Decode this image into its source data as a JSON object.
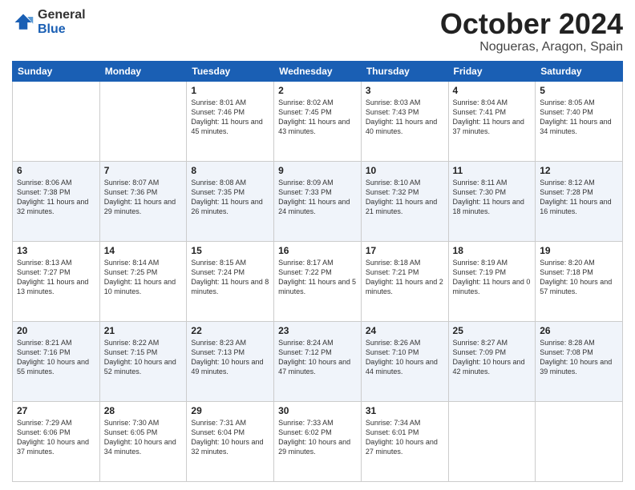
{
  "logo": {
    "general": "General",
    "blue": "Blue"
  },
  "title": "October 2024",
  "subtitle": "Nogueras, Aragon, Spain",
  "days_of_week": [
    "Sunday",
    "Monday",
    "Tuesday",
    "Wednesday",
    "Thursday",
    "Friday",
    "Saturday"
  ],
  "weeks": [
    [
      {
        "day": "",
        "info": ""
      },
      {
        "day": "",
        "info": ""
      },
      {
        "day": "1",
        "info": "Sunrise: 8:01 AM\nSunset: 7:46 PM\nDaylight: 11 hours and 45 minutes."
      },
      {
        "day": "2",
        "info": "Sunrise: 8:02 AM\nSunset: 7:45 PM\nDaylight: 11 hours and 43 minutes."
      },
      {
        "day": "3",
        "info": "Sunrise: 8:03 AM\nSunset: 7:43 PM\nDaylight: 11 hours and 40 minutes."
      },
      {
        "day": "4",
        "info": "Sunrise: 8:04 AM\nSunset: 7:41 PM\nDaylight: 11 hours and 37 minutes."
      },
      {
        "day": "5",
        "info": "Sunrise: 8:05 AM\nSunset: 7:40 PM\nDaylight: 11 hours and 34 minutes."
      }
    ],
    [
      {
        "day": "6",
        "info": "Sunrise: 8:06 AM\nSunset: 7:38 PM\nDaylight: 11 hours and 32 minutes."
      },
      {
        "day": "7",
        "info": "Sunrise: 8:07 AM\nSunset: 7:36 PM\nDaylight: 11 hours and 29 minutes."
      },
      {
        "day": "8",
        "info": "Sunrise: 8:08 AM\nSunset: 7:35 PM\nDaylight: 11 hours and 26 minutes."
      },
      {
        "day": "9",
        "info": "Sunrise: 8:09 AM\nSunset: 7:33 PM\nDaylight: 11 hours and 24 minutes."
      },
      {
        "day": "10",
        "info": "Sunrise: 8:10 AM\nSunset: 7:32 PM\nDaylight: 11 hours and 21 minutes."
      },
      {
        "day": "11",
        "info": "Sunrise: 8:11 AM\nSunset: 7:30 PM\nDaylight: 11 hours and 18 minutes."
      },
      {
        "day": "12",
        "info": "Sunrise: 8:12 AM\nSunset: 7:28 PM\nDaylight: 11 hours and 16 minutes."
      }
    ],
    [
      {
        "day": "13",
        "info": "Sunrise: 8:13 AM\nSunset: 7:27 PM\nDaylight: 11 hours and 13 minutes."
      },
      {
        "day": "14",
        "info": "Sunrise: 8:14 AM\nSunset: 7:25 PM\nDaylight: 11 hours and 10 minutes."
      },
      {
        "day": "15",
        "info": "Sunrise: 8:15 AM\nSunset: 7:24 PM\nDaylight: 11 hours and 8 minutes."
      },
      {
        "day": "16",
        "info": "Sunrise: 8:17 AM\nSunset: 7:22 PM\nDaylight: 11 hours and 5 minutes."
      },
      {
        "day": "17",
        "info": "Sunrise: 8:18 AM\nSunset: 7:21 PM\nDaylight: 11 hours and 2 minutes."
      },
      {
        "day": "18",
        "info": "Sunrise: 8:19 AM\nSunset: 7:19 PM\nDaylight: 11 hours and 0 minutes."
      },
      {
        "day": "19",
        "info": "Sunrise: 8:20 AM\nSunset: 7:18 PM\nDaylight: 10 hours and 57 minutes."
      }
    ],
    [
      {
        "day": "20",
        "info": "Sunrise: 8:21 AM\nSunset: 7:16 PM\nDaylight: 10 hours and 55 minutes."
      },
      {
        "day": "21",
        "info": "Sunrise: 8:22 AM\nSunset: 7:15 PM\nDaylight: 10 hours and 52 minutes."
      },
      {
        "day": "22",
        "info": "Sunrise: 8:23 AM\nSunset: 7:13 PM\nDaylight: 10 hours and 49 minutes."
      },
      {
        "day": "23",
        "info": "Sunrise: 8:24 AM\nSunset: 7:12 PM\nDaylight: 10 hours and 47 minutes."
      },
      {
        "day": "24",
        "info": "Sunrise: 8:26 AM\nSunset: 7:10 PM\nDaylight: 10 hours and 44 minutes."
      },
      {
        "day": "25",
        "info": "Sunrise: 8:27 AM\nSunset: 7:09 PM\nDaylight: 10 hours and 42 minutes."
      },
      {
        "day": "26",
        "info": "Sunrise: 8:28 AM\nSunset: 7:08 PM\nDaylight: 10 hours and 39 minutes."
      }
    ],
    [
      {
        "day": "27",
        "info": "Sunrise: 7:29 AM\nSunset: 6:06 PM\nDaylight: 10 hours and 37 minutes."
      },
      {
        "day": "28",
        "info": "Sunrise: 7:30 AM\nSunset: 6:05 PM\nDaylight: 10 hours and 34 minutes."
      },
      {
        "day": "29",
        "info": "Sunrise: 7:31 AM\nSunset: 6:04 PM\nDaylight: 10 hours and 32 minutes."
      },
      {
        "day": "30",
        "info": "Sunrise: 7:33 AM\nSunset: 6:02 PM\nDaylight: 10 hours and 29 minutes."
      },
      {
        "day": "31",
        "info": "Sunrise: 7:34 AM\nSunset: 6:01 PM\nDaylight: 10 hours and 27 minutes."
      },
      {
        "day": "",
        "info": ""
      },
      {
        "day": "",
        "info": ""
      }
    ]
  ]
}
